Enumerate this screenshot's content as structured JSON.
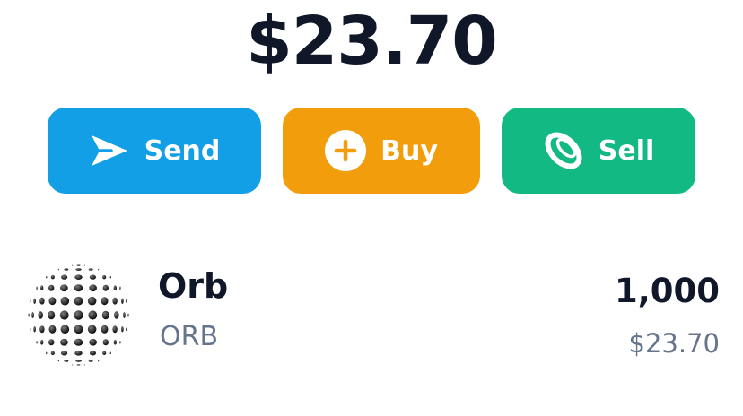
{
  "wallet": {
    "balance": "$23.70"
  },
  "actions": {
    "send": {
      "label": "Send",
      "color": "#129fe6",
      "icon": "paper-plane-icon"
    },
    "buy": {
      "label": "Buy",
      "color": "#f29e0c",
      "icon": "plus-circle-icon"
    },
    "sell": {
      "label": "Sell",
      "color": "#13b982",
      "icon": "coin-icon"
    }
  },
  "assets": [
    {
      "name": "Orb",
      "symbol": "ORB",
      "amount": "1,000",
      "value": "$23.70",
      "icon": "orb-sphere-logo"
    }
  ],
  "colors": {
    "text_primary": "#0f1729",
    "text_secondary": "#66748c"
  }
}
